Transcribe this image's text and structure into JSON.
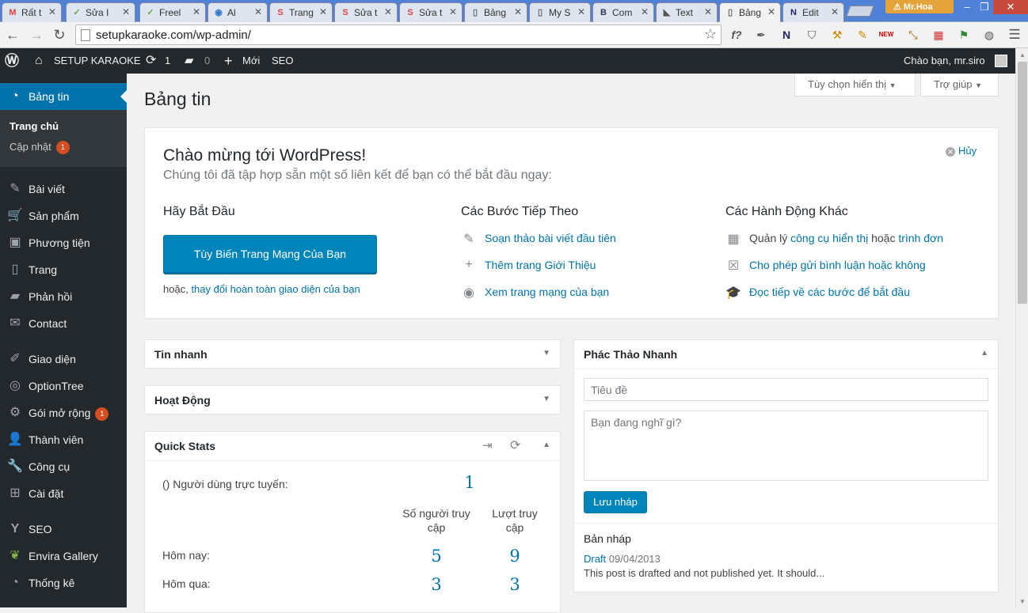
{
  "browser": {
    "tabs": [
      {
        "title": "Rất t",
        "icon": "M",
        "color": "#d44"
      },
      {
        "title": "Sửa I",
        "icon": "✓",
        "color": "#6a4"
      },
      {
        "title": "Freel",
        "icon": "✓",
        "color": "#6a4"
      },
      {
        "title": "Al",
        "icon": "◉",
        "color": "#37c"
      },
      {
        "title": "Trang",
        "icon": "S",
        "color": "#d44"
      },
      {
        "title": "Sửa t",
        "icon": "S",
        "color": "#d44"
      },
      {
        "title": "Sửa t",
        "icon": "S",
        "color": "#d44"
      },
      {
        "title": "Bảng",
        "icon": "▯",
        "color": "#666"
      },
      {
        "title": "My S",
        "icon": "▯",
        "color": "#666"
      },
      {
        "title": "Com",
        "icon": "B",
        "color": "#335"
      },
      {
        "title": "Text",
        "icon": "◣",
        "color": "#555"
      },
      {
        "title": "Bảng",
        "icon": "▯",
        "color": "#666"
      },
      {
        "title": "Edit",
        "icon": "N",
        "color": "#226"
      }
    ],
    "user": "Mr.Hoa",
    "url": "setupkaraoke.com/wp-admin/",
    "extensions": [
      "f?",
      "✒",
      "N",
      "⛉",
      "⚒",
      "✎",
      "NEW",
      "⤡",
      "▦",
      "⚑",
      "◍",
      "☰"
    ]
  },
  "adminbar": {
    "site_name": "SETUP KARAOKE",
    "updates": "1",
    "comments": "0",
    "new_label": "Mới",
    "seo_label": "SEO",
    "greeting": "Chào bạn, mr.siro"
  },
  "sidebar": {
    "active": "Bảng tin",
    "sub_home": "Trang chủ",
    "sub_updates": "Cập nhật",
    "sub_updates_count": "1",
    "items": [
      {
        "label": "Bài viết",
        "icon": "✎"
      },
      {
        "label": "Sản phẩm",
        "icon": "🛒"
      },
      {
        "label": "Phương tiện",
        "icon": "▣"
      },
      {
        "label": "Trang",
        "icon": "▯"
      },
      {
        "label": "Phản hồi",
        "icon": "▰"
      },
      {
        "label": "Contact",
        "icon": "✉"
      },
      {
        "label": "Giao diện",
        "icon": "✐"
      },
      {
        "label": "OptionTree",
        "icon": "◎"
      },
      {
        "label": "Gói mở rộng",
        "icon": "⚙",
        "badge": "1"
      },
      {
        "label": "Thành viên",
        "icon": "👤"
      },
      {
        "label": "Công cụ",
        "icon": "🔧"
      },
      {
        "label": "Cài đặt",
        "icon": "⊞"
      },
      {
        "label": "SEO",
        "icon": "Y"
      },
      {
        "label": "Envira Gallery",
        "icon": "❦"
      },
      {
        "label": "Thống kê",
        "icon": "◔"
      }
    ]
  },
  "screen_options": "Tùy chọn hiển thị",
  "help": "Trợ giúp",
  "page_title": "Bảng tin",
  "welcome": {
    "title": "Chào mừng tới WordPress!",
    "about": "Chúng tôi đã tập hợp sẵn một số liên kết để bạn có thể bắt đầu ngay:",
    "dismiss": "Hủy",
    "col1_title": "Hãy Bắt Đầu",
    "customize_button": "Tùy Biến Trang Mạng Của Bạn",
    "or_text": "hoặc,",
    "or_link": "thay đổi hoàn toàn giao diện của bạn",
    "col2_title": "Các Bước Tiếp Theo",
    "next_steps": [
      "Soạn thảo bài viết đầu tiên",
      "Thêm trang Giới Thiệu",
      "Xem trang mạng của bạn"
    ],
    "col3_title": "Các Hành Động Khác",
    "manage_prefix": "Quản lý",
    "manage_link1": "công cụ hiển thị",
    "manage_mid": "hoặc",
    "manage_link2": "trình đơn",
    "comments_toggle": "Cho phép gửi bình luận hoặc không",
    "learn_more": "Đọc tiếp về các bước để bắt đầu"
  },
  "boxes": {
    "at_glance": "Tin nhanh",
    "activity": "Hoạt Động",
    "quick_stats": "Quick Stats",
    "quick_draft": "Phác Thảo Nhanh"
  },
  "quick_stats": {
    "online_label": "() Người dùng trực tuyến:",
    "online_value": "1",
    "col_visitors": "Số người truy cập",
    "col_views": "Lượt truy cập",
    "today_label": "Hôm nay:",
    "today_visitors": "5",
    "today_views": "9",
    "yesterday_label": "Hôm qua:",
    "yesterday_visitors": "3",
    "yesterday_views": "3"
  },
  "quick_draft": {
    "title_placeholder": "Tiêu đề",
    "content_placeholder": "Bạn đang nghĩ gì?",
    "save_button": "Lưu nháp",
    "drafts_heading": "Bản nháp",
    "draft_title": "Draft",
    "draft_date": "09/04/2013",
    "draft_excerpt": "This post is drafted and not published yet. It should..."
  }
}
